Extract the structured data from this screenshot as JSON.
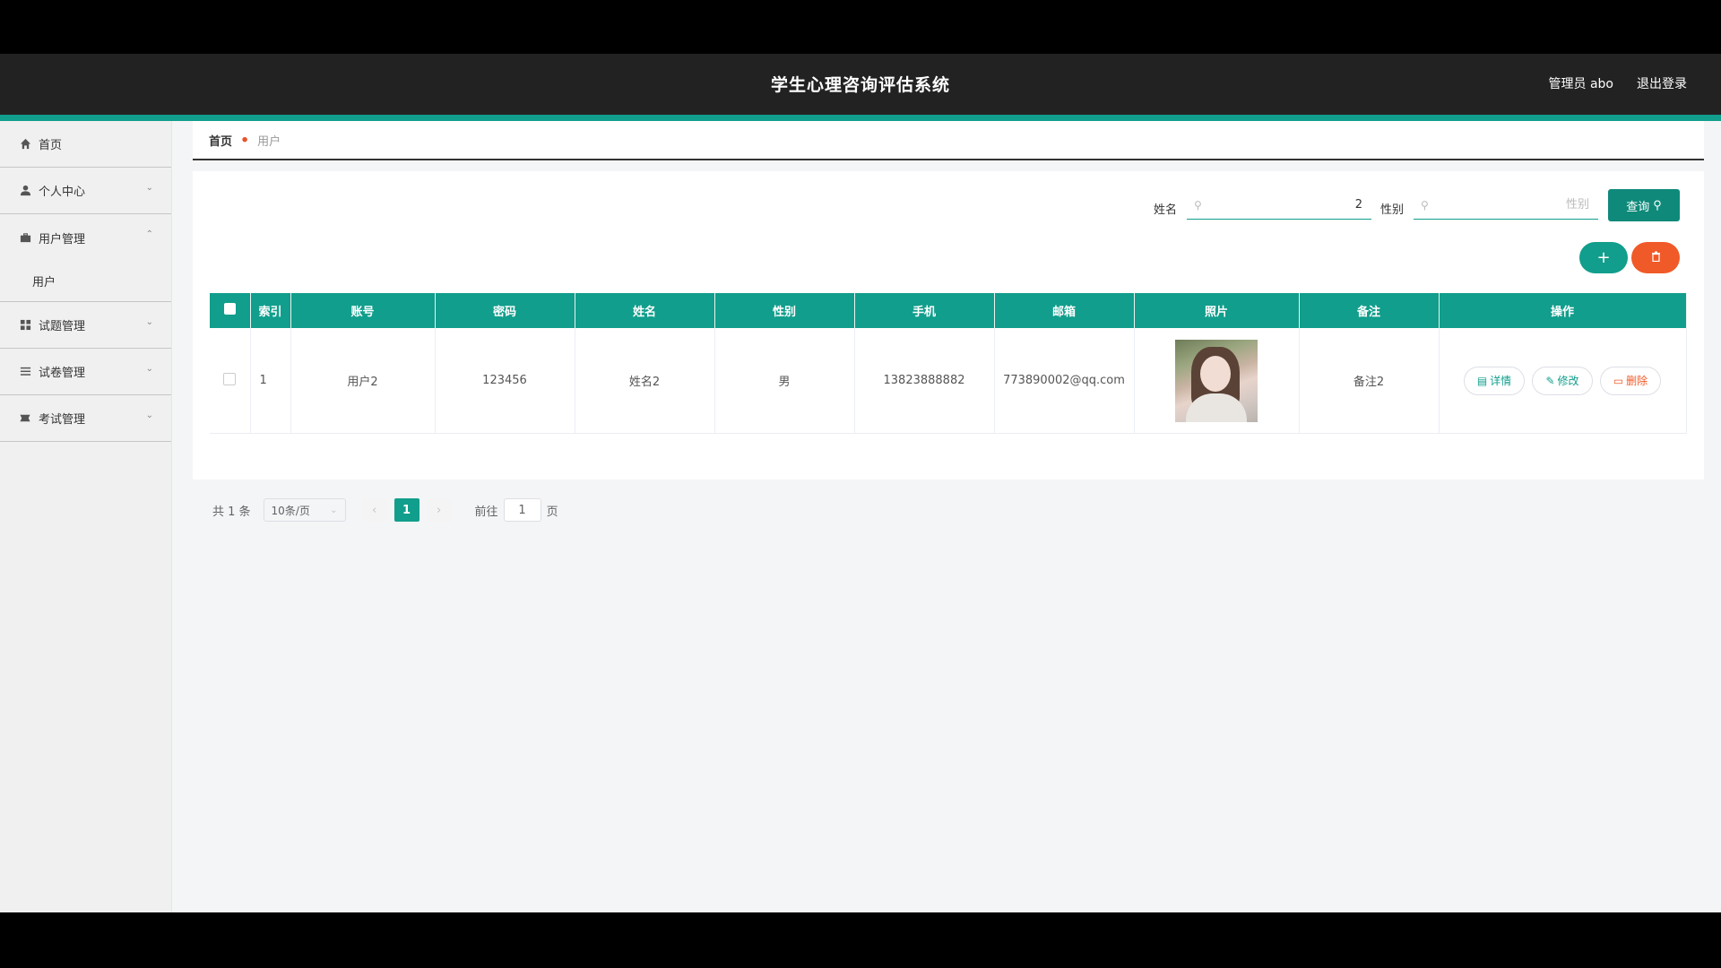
{
  "header": {
    "title": "学生心理咨询评估系统",
    "admin": "管理员 abo",
    "logout": "退出登录"
  },
  "sidebar": {
    "items": [
      {
        "label": "首页",
        "icon": "home-icon"
      },
      {
        "label": "个人中心",
        "icon": "user-icon",
        "expanded": false
      },
      {
        "label": "用户管理",
        "icon": "briefcase-icon",
        "expanded": true,
        "children": [
          "用户"
        ]
      },
      {
        "label": "试题管理",
        "icon": "grid-icon",
        "expanded": false
      },
      {
        "label": "试卷管理",
        "icon": "list-icon",
        "expanded": false
      },
      {
        "label": "考试管理",
        "icon": "card-icon",
        "expanded": false
      }
    ]
  },
  "breadcrumb": {
    "home": "首页",
    "current": "用户"
  },
  "search": {
    "name_label": "姓名",
    "name_value": "2",
    "gender_label": "性别",
    "gender_placeholder": "性别",
    "query_button": "查询"
  },
  "table": {
    "headers": [
      "索引",
      "账号",
      "密码",
      "姓名",
      "性别",
      "手机",
      "邮箱",
      "照片",
      "备注",
      "操作"
    ],
    "rows": [
      {
        "index": "1",
        "account": "用户2",
        "password": "123456",
        "name": "姓名2",
        "gender": "男",
        "phone": "13823888882",
        "email": "773890002@qq.com",
        "note": "备注2",
        "actions": {
          "detail": "详情",
          "edit": "修改",
          "delete": "删除"
        }
      }
    ]
  },
  "pagination": {
    "total": "共 1 条",
    "page_size": "10条/页",
    "current_page": "1",
    "goto_prefix": "前往",
    "goto_value": "1",
    "goto_suffix": "页"
  },
  "colors": {
    "accent": "#119e8c",
    "danger": "#f05a28",
    "header_bg": "#222222"
  }
}
